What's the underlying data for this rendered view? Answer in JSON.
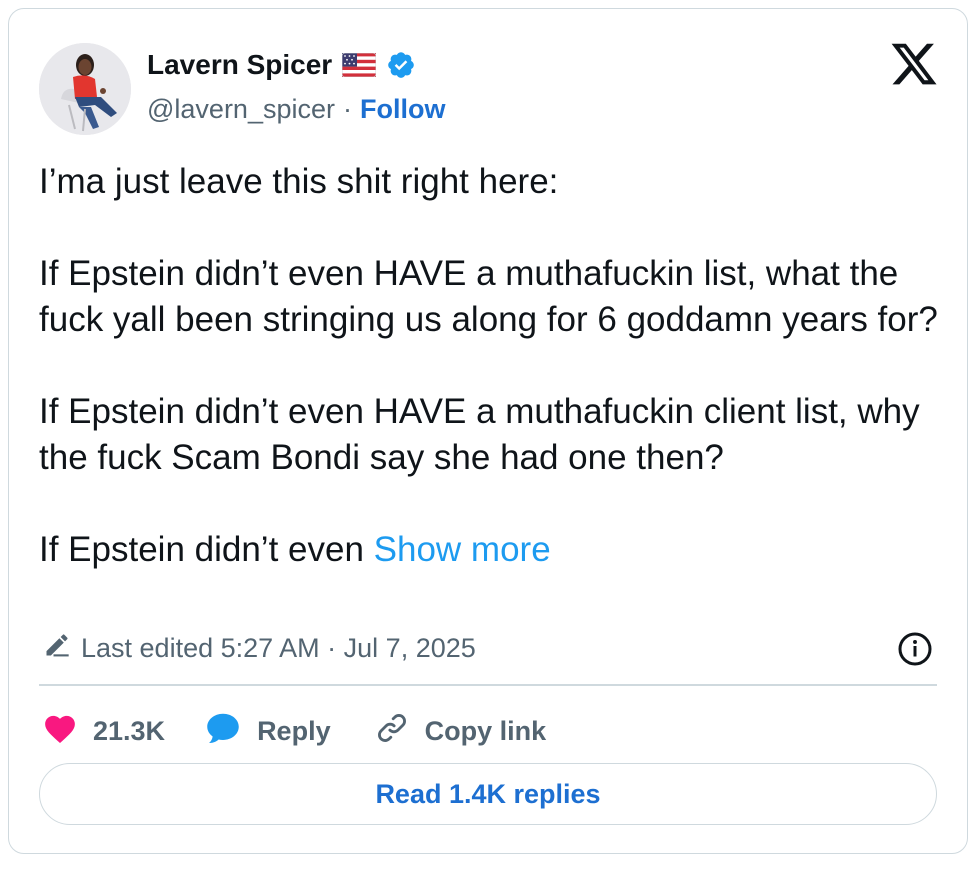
{
  "author": {
    "name": "Lavern Spicer",
    "handle": "@lavern_spicer",
    "separator": "·",
    "follow_label": "Follow"
  },
  "icons": {
    "flag": "us-flag-icon",
    "verified": "verified-badge-icon",
    "logo": "x-logo-icon",
    "edit": "pencil-icon",
    "info": "info-icon",
    "like": "heart-icon",
    "reply": "speech-bubble-icon",
    "link": "link-icon"
  },
  "tweet": {
    "text": "I’ma just leave this shit right here:\n\nIf Epstein didn’t even HAVE a muthafuckin list, what the fuck yall been stringing us along for 6 goddamn years for?\n\nIf Epstein didn’t even HAVE a muthafuckin client list, why the fuck Scam Bondi say she had one then?\n\nIf Epstein didn’t even ",
    "show_more": "Show more",
    "edited": "Last edited 5:27 AM · Jul 7, 2025"
  },
  "actions": {
    "likes": "21.3K",
    "reply": "Reply",
    "copy_link": "Copy link"
  },
  "replies_button": "Read 1.4K replies",
  "colors": {
    "like": "#f91880",
    "reply": "#1d9bf0",
    "link_blue": "#1d6fd1",
    "show_more": "#1d9bf0",
    "verified": "#1d9bf0",
    "muted": "#536471",
    "border": "#cfd9de"
  }
}
